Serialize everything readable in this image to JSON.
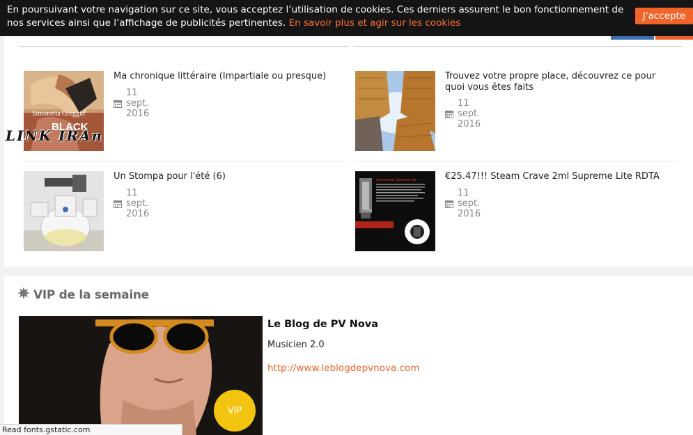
{
  "cookie_banner": {
    "text": "En poursuivant votre navigation sur ce site, vous acceptez l’utilisation de cookies. Ces derniers assurent le bon fonctionnement de nos services ainsi que l’affichage de publicités pertinentes.",
    "link": "En savoir plus et agir sur les cookies",
    "accept": "J'accepte"
  },
  "articles": [
    {
      "title": "Ma chronique littéraire (Impartiale ou presque)",
      "date": "11 sept. 2016",
      "thumb_author": "Simonetta Greggio",
      "thumb_title": "BLACK"
    },
    {
      "title": "Trouvez votre propre place, découvrez ce pour quoi vous êtes faits",
      "date": "11 sept. 2016"
    },
    {
      "title": "Un Stompa pour l'été (6)",
      "date": "11 sept. 2016"
    },
    {
      "title": "€25.47!!! Steam Crave 2ml Supreme Lite RDTA",
      "date": "11 sept. 2016",
      "thumb_label": "Aromamizer Supreme Lite",
      "thumb_size": "22MM"
    }
  ],
  "watermark": "LINK IRAn",
  "vip": {
    "heading": "VIP de la semaine",
    "name": "Le Blog de PV Nova",
    "description": "Musicien 2.0",
    "url": "http://www.leblogdepvnova.com",
    "badge": "VIP"
  },
  "status_bar": "Read fonts.gstatic.com",
  "colors": {
    "accent": "#f0642a",
    "banner_bg": "#151515",
    "vip_badge": "#f3c511",
    "meta_gray": "#888888"
  }
}
